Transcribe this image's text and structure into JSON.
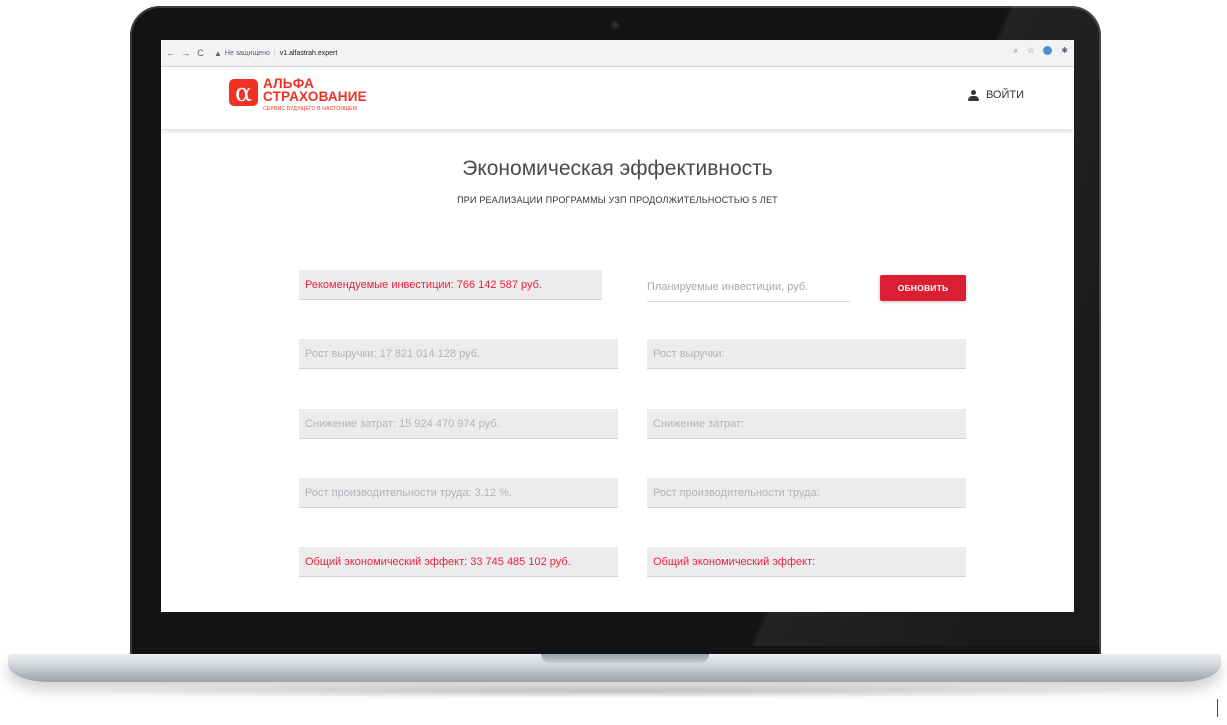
{
  "browser": {
    "nav_back": "←",
    "nav_forward": "→",
    "nav_reload": "C",
    "security_label": "Не защищено",
    "url": "v1.alfastrah.expert",
    "icon_zoom": "⌕",
    "icon_star": "☆",
    "icon_puzzle": "✱"
  },
  "header": {
    "logo_symbol": "α",
    "logo_line1": "АЛЬФА",
    "logo_line2": "СТРАХОВАНИЕ",
    "logo_tagline": "СЕРВИС БУДУЩЕГО В НАСТОЯЩЕМ",
    "login_label": "ВОЙТИ"
  },
  "page": {
    "title": "Экономическая эффективность",
    "subtitle": "ПРИ РЕАЛИЗАЦИИ ПРОГРАММЫ УЗП ПРОДОЛЖИТЕЛЬНОСТЬЮ 5 ЛЕТ"
  },
  "recommended": {
    "investments": "Рекомендуемые инвестиции:  766 142 587 руб.",
    "revenue_growth": "Рост выручки:  17 821 014 128 руб.",
    "cost_reduction": "Снижение затрат:  15 924 470 974 руб.",
    "productivity_growth": "Рост производительности труда: 3.12 %.",
    "total_effect": "Общий экономический эффект: 33 745 485 102 руб."
  },
  "planned": {
    "investments_placeholder": "Планируемые инвестиции, руб.",
    "investments_value": "",
    "update_label": "ОБНОВИТЬ",
    "revenue_growth": "Рост выручки:",
    "cost_reduction": "Снижение затрат:",
    "productivity_growth": "Рост производительности труда:",
    "total_effect": "Общий экономический эффект:"
  },
  "colors": {
    "brand_red": "#ef3124",
    "accent_red": "#e8233d",
    "button_red": "#dc1e32",
    "field_bg": "#ececee"
  }
}
